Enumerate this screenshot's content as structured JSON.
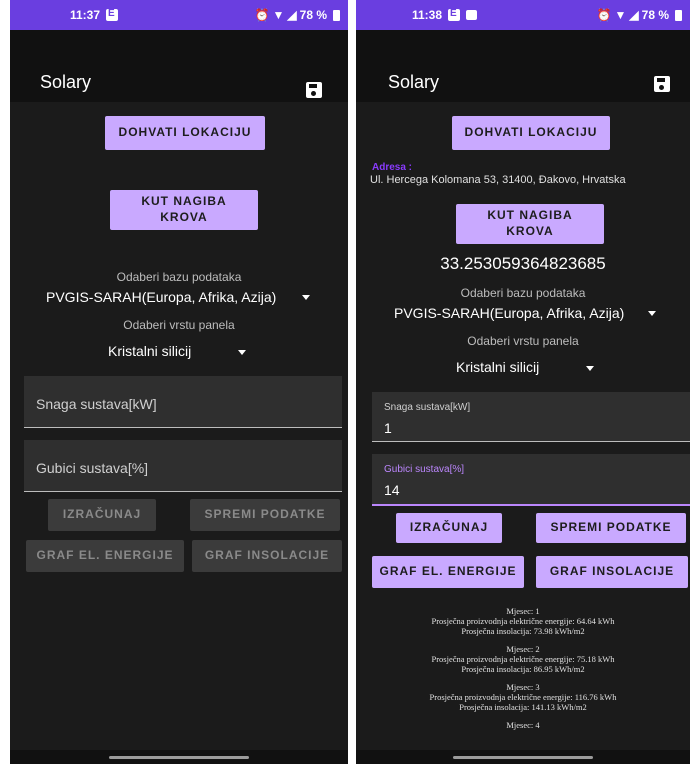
{
  "left": {
    "status": {
      "time": "11:37",
      "battery": "78 %"
    },
    "app_title": "Solary",
    "buttons": {
      "location": "DOHVATI LOKACIJU",
      "roof_angle": "KUT NAGIBA KROVA",
      "calculate": "IZRAČUNAJ",
      "save_data": "SPREMI PODATKE",
      "energy_graph": "GRAF EL. ENERGIJE",
      "insolation_graph": "GRAF INSOLACIJE"
    },
    "database_label": "Odaberi bazu podataka",
    "database_value": "PVGIS-SARAH(Europa, Afrika, Azija)",
    "panel_label": "Odaberi vrstu panela",
    "panel_value": "Kristalni silicij",
    "power_placeholder": "Snaga sustava[kW]",
    "losses_placeholder": "Gubici sustava[%]"
  },
  "right": {
    "status": {
      "time": "11:38",
      "battery": "78 %"
    },
    "app_title": "Solary",
    "buttons": {
      "location": "DOHVATI LOKACIJU",
      "roof_angle": "KUT NAGIBA KROVA",
      "calculate": "IZRAČUNAJ",
      "save_data": "SPREMI PODATKE",
      "energy_graph": "GRAF EL. ENERGIJE",
      "insolation_graph": "GRAF INSOLACIJE"
    },
    "address_label": "Adresa :",
    "address_value": "Ul. Hercega Kolomana 53, 31400, Đakovo, Hrvatska",
    "angle_value": "33.253059364823685",
    "database_label": "Odaberi bazu podataka",
    "database_value": "PVGIS-SARAH(Europa, Afrika, Azija)",
    "panel_label": "Odaberi vrstu panela",
    "panel_value": "Kristalni silicij",
    "power_label": "Snaga sustava[kW]",
    "power_value": "1",
    "losses_label": "Gubici sustava[%]",
    "losses_value": "14",
    "results": [
      {
        "month": "Mjesec: 1",
        "energy": "Prosječna proizvodnja električne energije: 64.64 kWh",
        "insolation": "Prosječna insolacija: 73.98 kWh/m2"
      },
      {
        "month": "Mjesec: 2",
        "energy": "Prosječna proizvodnja električne energije: 75.18 kWh",
        "insolation": "Prosječna insolacija: 86.95 kWh/m2"
      },
      {
        "month": "Mjesec: 3",
        "energy": "Prosječna proizvodnja električne energije: 116.76 kWh",
        "insolation": "Prosječna insolacija: 141.13 kWh/m2"
      },
      {
        "month": "Mjesec: 4",
        "energy": "",
        "insolation": ""
      }
    ]
  }
}
